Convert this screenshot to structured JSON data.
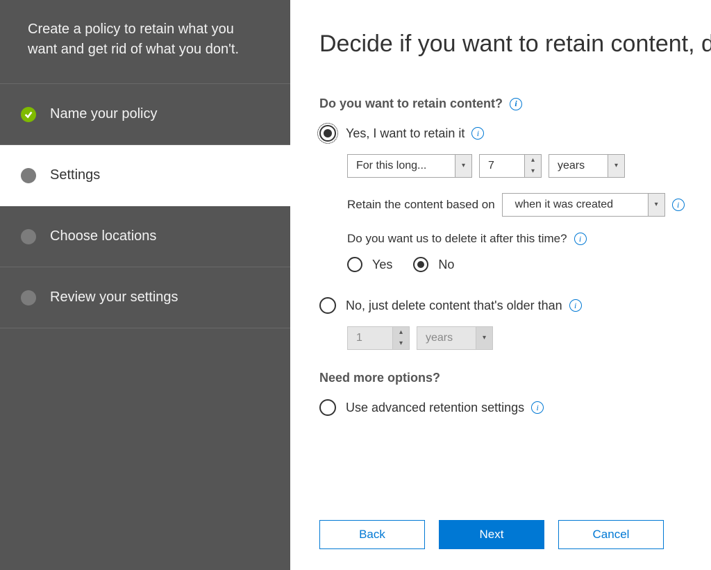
{
  "sidebar": {
    "description": "Create a policy to retain what you want and get rid of what you don't.",
    "steps": [
      {
        "label": "Name your policy",
        "state": "done"
      },
      {
        "label": "Settings",
        "state": "active"
      },
      {
        "label": "Choose locations",
        "state": "upcoming"
      },
      {
        "label": "Review your settings",
        "state": "upcoming"
      }
    ]
  },
  "main": {
    "title": "Decide if you want to retain content, d",
    "q1_label": "Do you want to retain content?",
    "opt_retain": "Yes, I want to retain it",
    "for_this_long": "For this long...",
    "duration_value": "7",
    "duration_unit": "years",
    "based_on_label": "Retain the content based on",
    "based_on_value": "when it was created",
    "q2_label": "Do you want us to delete it after this time?",
    "yes": "Yes",
    "no": "No",
    "opt_delete_only": "No, just delete content that's older than",
    "del_value": "1",
    "del_unit": "years",
    "more_options_label": "Need more options?",
    "advanced_label": "Use advanced retention settings",
    "back": "Back",
    "next": "Next",
    "cancel": "Cancel"
  }
}
